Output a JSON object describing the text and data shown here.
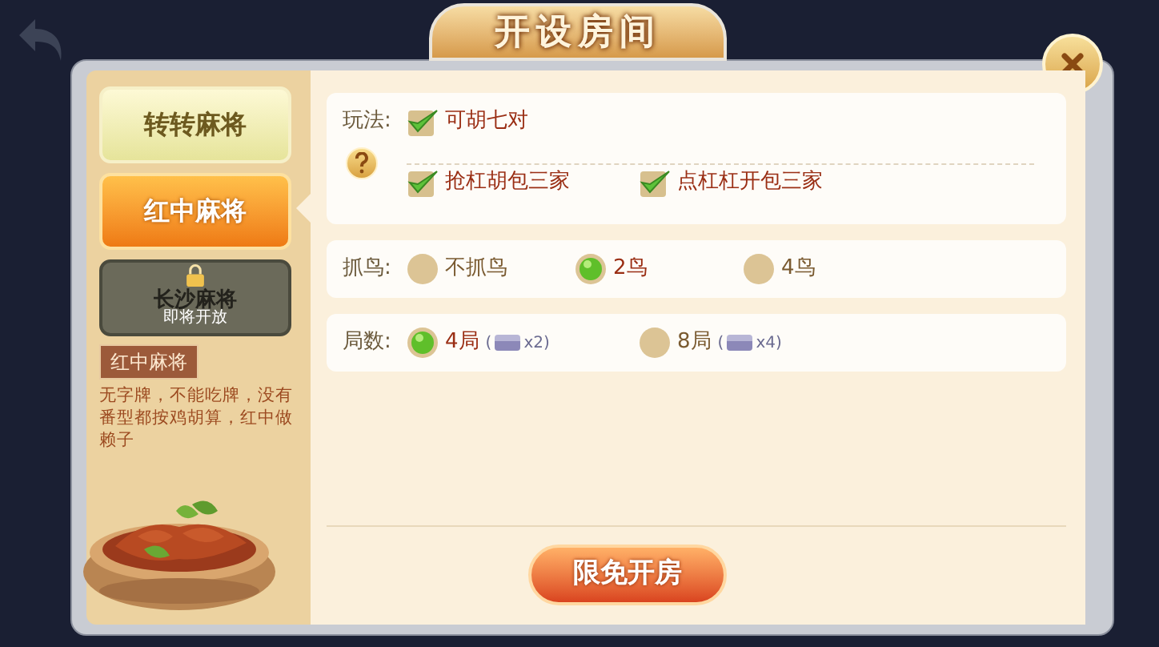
{
  "title": "开设房间",
  "games": [
    {
      "label": "转转麻将",
      "kind": "tab",
      "selected": false
    },
    {
      "label": "红中麻将",
      "kind": "tab",
      "selected": true
    },
    {
      "label": "长沙麻将",
      "kind": "locked",
      "selected": false,
      "note": "即将开放"
    }
  ],
  "description": {
    "title": "红中麻将",
    "text": "无字牌，不能吃牌，没有番型都按鸡胡算，红中做赖子"
  },
  "rules": [
    {
      "label": "玩法:",
      "kind": "checkbox",
      "options": [
        [
          {
            "label": "可胡七对",
            "checked": true
          }
        ],
        [
          {
            "label": "抢杠胡包三家",
            "checked": true
          },
          {
            "label": "点杠杠开包三家",
            "checked": true
          }
        ]
      ]
    },
    {
      "label": "抓鸟:",
      "kind": "radio",
      "options": [
        [
          {
            "label": "不抓鸟",
            "selected": false
          },
          {
            "label": "2鸟",
            "selected": true
          },
          {
            "label": "4鸟",
            "selected": false
          }
        ]
      ]
    },
    {
      "label": "局数:",
      "kind": "radio",
      "options": [
        [
          {
            "label": "4局",
            "cost_open": "(",
            "cost": "x2)",
            "selected": true
          },
          {
            "label": "8局",
            "cost_open": "(",
            "cost": "x4)",
            "selected": false
          }
        ]
      ]
    }
  ],
  "create_button": "限免开房"
}
